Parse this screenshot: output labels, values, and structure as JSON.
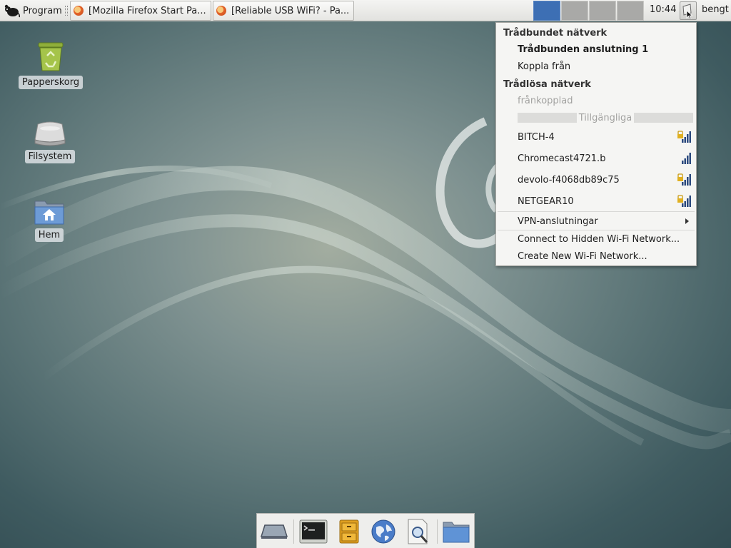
{
  "top_panel": {
    "apps_menu_label": "Program",
    "tasks": [
      {
        "title": "[Mozilla Firefox Start Pa..."
      },
      {
        "title": "[Reliable USB WiFi? - Pa..."
      }
    ],
    "workspaces": [
      {
        "active": true
      },
      {
        "active": false
      },
      {
        "active": false
      },
      {
        "active": false
      }
    ],
    "clock": "10:44",
    "user": "bengt"
  },
  "desktop": {
    "icons": [
      {
        "label": "Papperskorg",
        "icon": "trash-icon"
      },
      {
        "label": "Filsystem",
        "icon": "drive-icon"
      },
      {
        "label": "Hem",
        "icon": "home-folder-icon"
      }
    ]
  },
  "network_menu": {
    "wired_header": "Trådbundet nätverk",
    "wired_connection": "Trådbunden anslutning 1",
    "disconnect": "Koppla från",
    "wireless_header": "Trådlösa nätverk",
    "wireless_status": "frånkopplad",
    "available_label": "Tillgängliga",
    "networks": [
      {
        "ssid": "BITCH-4",
        "locked": true,
        "signal_bars": 4
      },
      {
        "ssid": "Chromecast4721.b",
        "locked": false,
        "signal_bars": 4
      },
      {
        "ssid": "devolo-f4068db89c75",
        "locked": true,
        "signal_bars": 4
      },
      {
        "ssid": "NETGEAR10",
        "locked": true,
        "signal_bars": 4
      }
    ],
    "vpn": "VPN-anslutningar",
    "connect_hidden": "Connect to Hidden Wi-Fi Network...",
    "create_new": "Create New Wi-Fi Network..."
  },
  "dock": {
    "items": [
      {
        "icon": "show-desktop-icon"
      },
      {
        "icon": "terminal-icon"
      },
      {
        "icon": "file-cabinet-icon"
      },
      {
        "icon": "web-browser-icon"
      },
      {
        "icon": "app-finder-icon"
      },
      {
        "icon": "folder-icon"
      }
    ]
  },
  "colors": {
    "workspace_active": "#3d6fb4",
    "signal_bars": "#2c4a7e",
    "lock": "#e0b020"
  }
}
